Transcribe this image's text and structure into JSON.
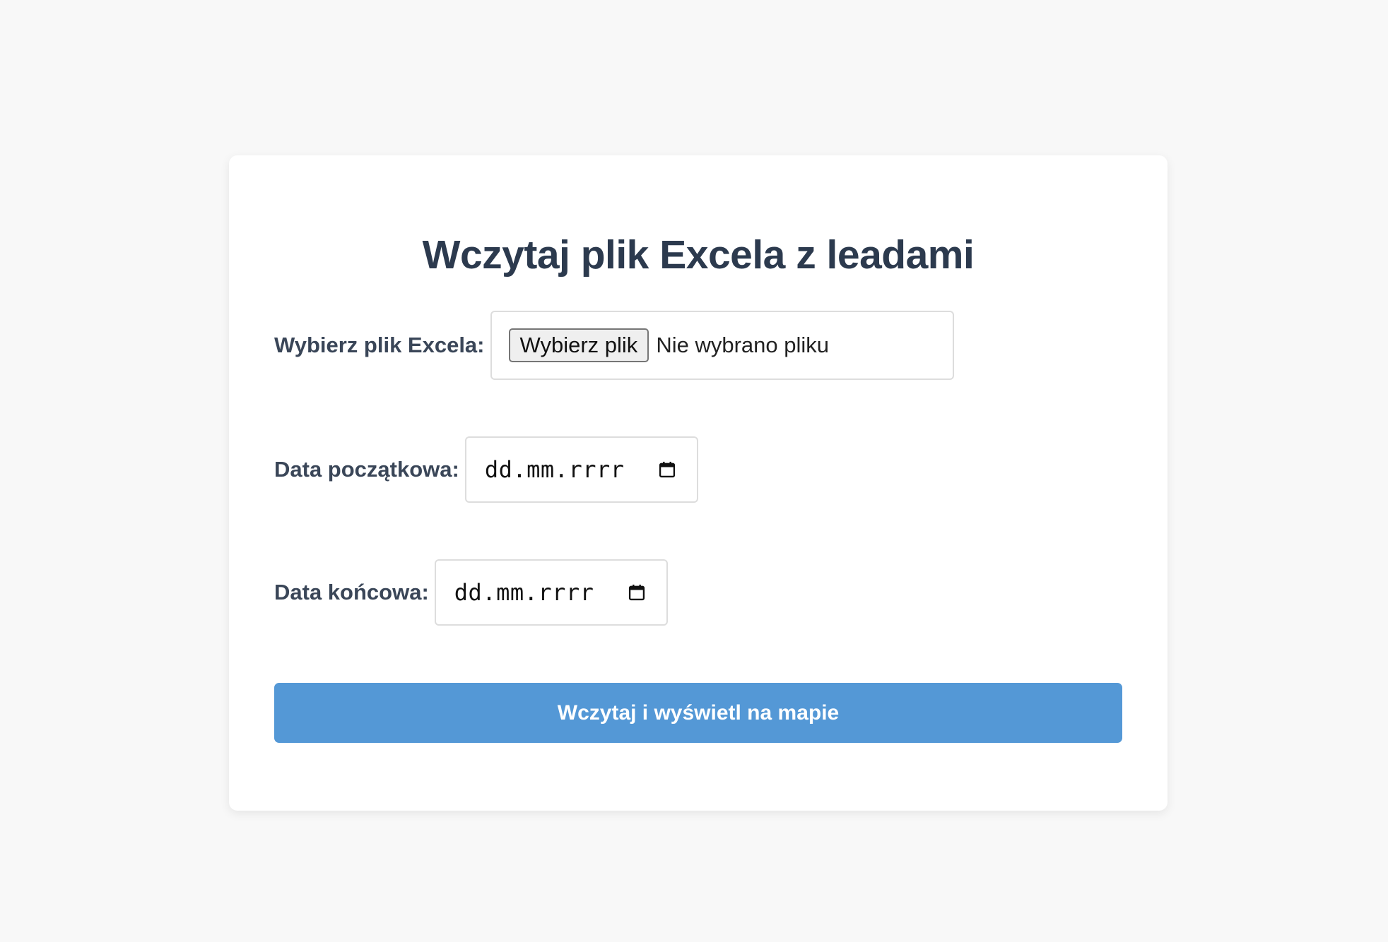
{
  "page": {
    "title": "Wczytaj plik Excela z leadami"
  },
  "form": {
    "file": {
      "label": "Wybierz plik Excela:",
      "button_label": "Wybierz plik",
      "status": "Nie wybrano pliku"
    },
    "start_date": {
      "label": "Data początkowa:",
      "placeholder": "dd.mm.rrrr",
      "icon": "calendar-icon"
    },
    "end_date": {
      "label": "Data końcowa:",
      "placeholder": "dd.mm.rrrr",
      "icon": "calendar-icon"
    },
    "submit_label": "Wczytaj i wyświetl na mapie"
  },
  "colors": {
    "background": "#f8f8f8",
    "card": "#ffffff",
    "title": "#2c3a4e",
    "label": "#3a4658",
    "button": "#5498d6",
    "button_text": "#ffffff"
  }
}
